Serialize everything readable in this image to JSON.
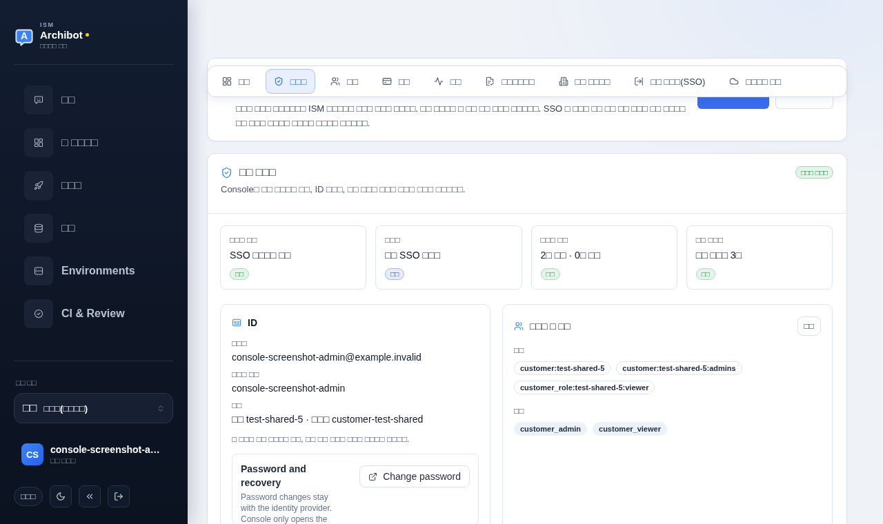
{
  "sidebar": {
    "brand": {
      "mark": "A",
      "eyebrow": "ISM",
      "name": "Archibot",
      "subtitle": "□□□□ □□"
    },
    "nav": [
      {
        "label": "□□",
        "selected": false
      },
      {
        "label": "□ □□□□",
        "selected": false
      },
      {
        "label": "□□□",
        "selected": false
      },
      {
        "label": "□□",
        "selected": false
      },
      {
        "label": "Environments",
        "selected": false
      },
      {
        "label": "CI & Review",
        "selected": false
      }
    ],
    "workspace": {
      "label": "□□ □□",
      "flag": "□□",
      "value": "□□□(□□□□)"
    },
    "user": {
      "initials": "CS",
      "name": "console-screenshot-a…",
      "role": "□□ □□□"
    },
    "language_button": "□□□"
  },
  "tabs": [
    {
      "label": "□□",
      "selected": false
    },
    {
      "label": "□□□",
      "selected": true
    },
    {
      "label": "□□",
      "selected": false
    },
    {
      "label": "□□",
      "selected": false
    },
    {
      "label": "□□",
      "selected": false
    },
    {
      "label": "□□□□□□",
      "selected": false
    },
    {
      "label": "□□ □□□□",
      "selected": false
    },
    {
      "label": "□□ □□□(SSO)",
      "selected": false
    },
    {
      "label": "□□□□ □□",
      "selected": false
    }
  ],
  "intro": {
    "text": "□□□ □□□ □□□□□□ ISM □□□□□ □□□ □□□ □□□□. □□ □□□□ □ □□ □□ □□□ □□□□□. SSO □ □□□ □□ □□ □□ □□□ □□ □□□□ □□ □□□ □□□□ □□□□ □□□□ □□□□□."
  },
  "overview": {
    "title": "□□ □□□",
    "badge": "□□□ □□□",
    "description": "Console□ □□ □□□□ □□, ID □□□, □□ □□□ □□□ □□□ □□□ □□□□□.",
    "stats": [
      {
        "label": "□□□ □□",
        "value": "SSO □□□□ □□",
        "status": {
          "text": "□□",
          "color": "#e3f4e8"
        }
      },
      {
        "label": "□□□",
        "value": "□□ SSO □□□",
        "status": {
          "text": "□□",
          "color": "#e5ecfd"
        }
      },
      {
        "label": "□□□ □□",
        "value": "2□ □□ · 0□ □□",
        "status": {
          "text": "□□",
          "color": "#e3f4e8"
        }
      },
      {
        "label": "□□ □□□",
        "value": "□□ □□□ 3□",
        "status": {
          "text": "□□",
          "color": "#e3f4e8"
        }
      }
    ]
  },
  "identity": {
    "title": "ID",
    "fields": [
      {
        "label": "□□□",
        "value": "console-screenshot-admin@example.invalid"
      },
      {
        "label": "□□□ □□",
        "value": "console-screenshot-admin"
      },
      {
        "label": "□□",
        "value": "□□ test-shared-5 · □□□ customer-test-shared"
      }
    ],
    "note": "□ □□□ □□ □□□□ □□, □□ □□ □□□ □□□ □□□□ □□□□.",
    "password": {
      "title": "Password and recovery",
      "description": "Password changes stay with the identity provider. Console only opens the",
      "button": "Change password"
    }
  },
  "access": {
    "title": "□□□ □ □□",
    "button": "□□",
    "sections": [
      {
        "label": "□□",
        "kind": "outline",
        "chips": [
          "customer:test-shared-5",
          "customer:test-shared-5:admins",
          "customer_role:test-shared-5:viewer"
        ]
      },
      {
        "label": "□□",
        "kind": "filled",
        "chips": [
          "customer_admin",
          "customer_viewer"
        ]
      }
    ]
  }
}
